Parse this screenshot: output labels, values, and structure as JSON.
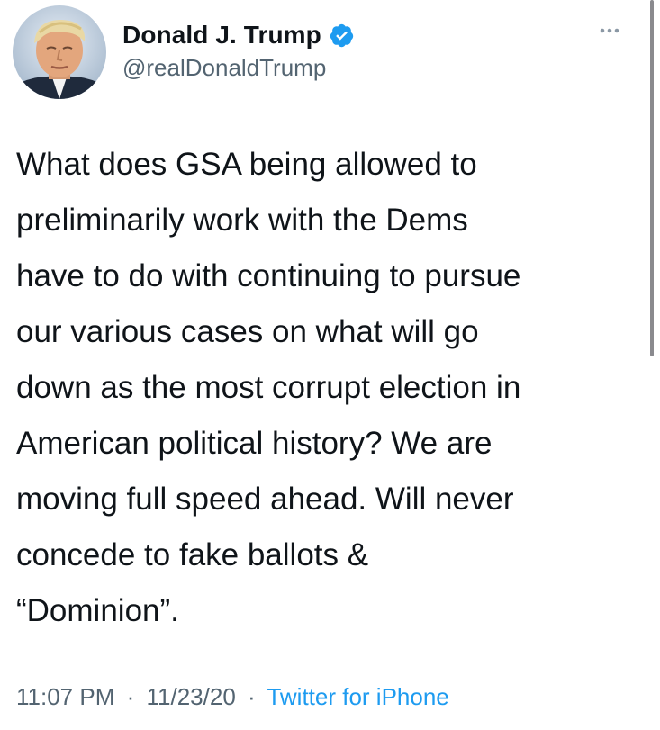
{
  "tweet": {
    "author": {
      "display_name": "Donald J. Trump",
      "handle": "@realDonaldTrump",
      "verified": true,
      "avatar_icon": "profile-photo"
    },
    "more_icon": "ellipsis-icon",
    "text": "What does GSA being allowed to\npreliminarily work with the Dems\nhave to do with continuing to pursue\nour various cases on what will go\ndown as the most corrupt election in\nAmerican political history? We are\nmoving full speed ahead. Will never\nconcede to fake ballots &\n“Dominion”.",
    "time": "11:07 PM",
    "date": "11/23/20",
    "separator": "·",
    "source": "Twitter for iPhone"
  },
  "colors": {
    "text": "#0f1419",
    "secondary": "#536471",
    "link": "#1d9bf0",
    "verified": "#1d9bf0"
  }
}
